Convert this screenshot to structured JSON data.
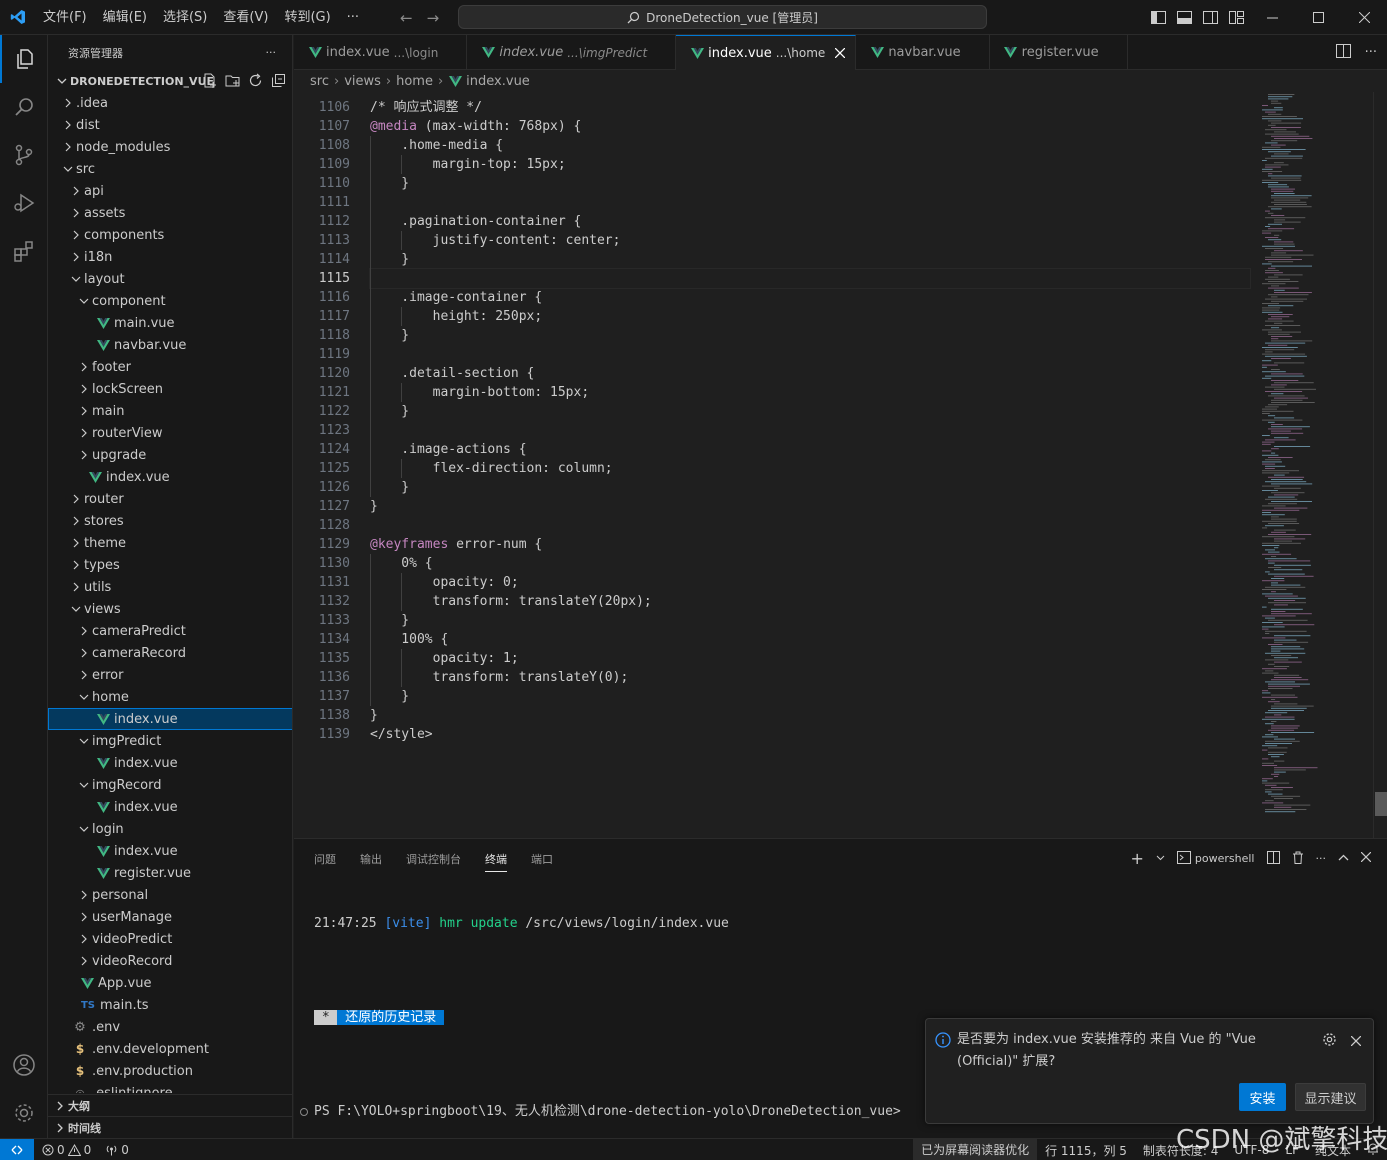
{
  "titlebar": {
    "menu": [
      "文件(F)",
      "编辑(E)",
      "选择(S)",
      "查看(V)",
      "转到(G)",
      "···"
    ],
    "command_center": "DroneDetection_vue [管理员]"
  },
  "sidebar": {
    "title": "资源管理器",
    "more": "···",
    "project": "DRONEDETECTION_VUE",
    "tree": [
      {
        "label": ".idea",
        "depth": 0,
        "type": "folder",
        "open": false
      },
      {
        "label": "dist",
        "depth": 0,
        "type": "folder",
        "open": false
      },
      {
        "label": "node_modules",
        "depth": 0,
        "type": "folder",
        "open": false
      },
      {
        "label": "src",
        "depth": 0,
        "type": "folder",
        "open": true
      },
      {
        "label": "api",
        "depth": 1,
        "type": "folder",
        "open": false
      },
      {
        "label": "assets",
        "depth": 1,
        "type": "folder",
        "open": false
      },
      {
        "label": "components",
        "depth": 1,
        "type": "folder",
        "open": false
      },
      {
        "label": "i18n",
        "depth": 1,
        "type": "folder",
        "open": false
      },
      {
        "label": "layout",
        "depth": 1,
        "type": "folder",
        "open": true
      },
      {
        "label": "component",
        "depth": 2,
        "type": "folder",
        "open": true
      },
      {
        "label": "main.vue",
        "depth": 3,
        "type": "vue"
      },
      {
        "label": "navbar.vue",
        "depth": 3,
        "type": "vue"
      },
      {
        "label": "footer",
        "depth": 2,
        "type": "folder",
        "open": false
      },
      {
        "label": "lockScreen",
        "depth": 2,
        "type": "folder",
        "open": false
      },
      {
        "label": "main",
        "depth": 2,
        "type": "folder",
        "open": false
      },
      {
        "label": "routerView",
        "depth": 2,
        "type": "folder",
        "open": false
      },
      {
        "label": "upgrade",
        "depth": 2,
        "type": "folder",
        "open": false
      },
      {
        "label": "index.vue",
        "depth": 2,
        "type": "vue"
      },
      {
        "label": "router",
        "depth": 1,
        "type": "folder",
        "open": false
      },
      {
        "label": "stores",
        "depth": 1,
        "type": "folder",
        "open": false
      },
      {
        "label": "theme",
        "depth": 1,
        "type": "folder",
        "open": false
      },
      {
        "label": "types",
        "depth": 1,
        "type": "folder",
        "open": false
      },
      {
        "label": "utils",
        "depth": 1,
        "type": "folder",
        "open": false
      },
      {
        "label": "views",
        "depth": 1,
        "type": "folder",
        "open": true
      },
      {
        "label": "cameraPredict",
        "depth": 2,
        "type": "folder",
        "open": false
      },
      {
        "label": "cameraRecord",
        "depth": 2,
        "type": "folder",
        "open": false
      },
      {
        "label": "error",
        "depth": 2,
        "type": "folder",
        "open": false
      },
      {
        "label": "home",
        "depth": 2,
        "type": "folder",
        "open": true
      },
      {
        "label": "index.vue",
        "depth": 3,
        "type": "vue",
        "selected": true
      },
      {
        "label": "imgPredict",
        "depth": 2,
        "type": "folder",
        "open": true
      },
      {
        "label": "index.vue",
        "depth": 3,
        "type": "vue"
      },
      {
        "label": "imgRecord",
        "depth": 2,
        "type": "folder",
        "open": true
      },
      {
        "label": "index.vue",
        "depth": 3,
        "type": "vue"
      },
      {
        "label": "login",
        "depth": 2,
        "type": "folder",
        "open": true
      },
      {
        "label": "index.vue",
        "depth": 3,
        "type": "vue"
      },
      {
        "label": "register.vue",
        "depth": 3,
        "type": "vue"
      },
      {
        "label": "personal",
        "depth": 2,
        "type": "folder",
        "open": false
      },
      {
        "label": "userManage",
        "depth": 2,
        "type": "folder",
        "open": false
      },
      {
        "label": "videoPredict",
        "depth": 2,
        "type": "folder",
        "open": false
      },
      {
        "label": "videoRecord",
        "depth": 2,
        "type": "folder",
        "open": false
      },
      {
        "label": "App.vue",
        "depth": 1,
        "type": "vue"
      },
      {
        "label": "main.ts",
        "depth": 1,
        "type": "ts"
      },
      {
        "label": ".env",
        "depth": 0,
        "type": "gear"
      },
      {
        "label": ".env.development",
        "depth": 0,
        "type": "dollar"
      },
      {
        "label": ".env.production",
        "depth": 0,
        "type": "dollar"
      },
      {
        "label": ".eslintignore",
        "depth": 0,
        "type": "circle"
      }
    ],
    "outline": "大纲",
    "timeline": "时间线"
  },
  "tabs": [
    {
      "name": "index.vue",
      "desc": "...\\login",
      "italic": false,
      "active": false
    },
    {
      "name": "index.vue",
      "desc": "...\\imgPredict",
      "italic": true,
      "active": false
    },
    {
      "name": "index.vue",
      "desc": "...\\home",
      "italic": false,
      "active": true
    },
    {
      "name": "navbar.vue",
      "desc": "",
      "italic": false,
      "active": false
    },
    {
      "name": "register.vue",
      "desc": "",
      "italic": false,
      "active": false
    }
  ],
  "breadcrumb": [
    "src",
    "views",
    "home",
    "index.vue"
  ],
  "editor": {
    "current_line": 1115,
    "lines": [
      {
        "n": 1106,
        "tokens": [
          [
            "/* 响应式调整 */",
            "comment"
          ]
        ]
      },
      {
        "n": 1107,
        "tokens": [
          [
            "@media",
            "at"
          ],
          [
            " (max-width: 768px) {",
            "plain"
          ]
        ]
      },
      {
        "n": 1108,
        "tokens": [
          [
            "    .home-media {",
            "plain"
          ]
        ]
      },
      {
        "n": 1109,
        "tokens": [
          [
            "        margin-top: 15px;",
            "plain"
          ]
        ]
      },
      {
        "n": 1110,
        "tokens": [
          [
            "    }",
            "plain"
          ]
        ]
      },
      {
        "n": 1111,
        "tokens": []
      },
      {
        "n": 1112,
        "tokens": [
          [
            "    .pagination-container {",
            "plain"
          ]
        ]
      },
      {
        "n": 1113,
        "tokens": [
          [
            "        justify-content: center;",
            "plain"
          ]
        ]
      },
      {
        "n": 1114,
        "tokens": [
          [
            "    }",
            "plain"
          ]
        ]
      },
      {
        "n": 1115,
        "tokens": []
      },
      {
        "n": 1116,
        "tokens": [
          [
            "    .image-container {",
            "plain"
          ]
        ]
      },
      {
        "n": 1117,
        "tokens": [
          [
            "        height: 250px;",
            "plain"
          ]
        ]
      },
      {
        "n": 1118,
        "tokens": [
          [
            "    }",
            "plain"
          ]
        ]
      },
      {
        "n": 1119,
        "tokens": []
      },
      {
        "n": 1120,
        "tokens": [
          [
            "    .detail-section {",
            "plain"
          ]
        ]
      },
      {
        "n": 1121,
        "tokens": [
          [
            "        margin-bottom: 15px;",
            "plain"
          ]
        ]
      },
      {
        "n": 1122,
        "tokens": [
          [
            "    }",
            "plain"
          ]
        ]
      },
      {
        "n": 1123,
        "tokens": []
      },
      {
        "n": 1124,
        "tokens": [
          [
            "    .image-actions {",
            "plain"
          ]
        ]
      },
      {
        "n": 1125,
        "tokens": [
          [
            "        flex-direction: column;",
            "plain"
          ]
        ]
      },
      {
        "n": 1126,
        "tokens": [
          [
            "    }",
            "plain"
          ]
        ]
      },
      {
        "n": 1127,
        "tokens": [
          [
            "}",
            "plain"
          ]
        ]
      },
      {
        "n": 1128,
        "tokens": []
      },
      {
        "n": 1129,
        "tokens": [
          [
            "@keyframes",
            "at"
          ],
          [
            " error-num {",
            "plain"
          ]
        ]
      },
      {
        "n": 1130,
        "tokens": [
          [
            "    0% {",
            "plain"
          ]
        ]
      },
      {
        "n": 1131,
        "tokens": [
          [
            "        opacity: 0;",
            "plain"
          ]
        ]
      },
      {
        "n": 1132,
        "tokens": [
          [
            "        transform: translateY(20px);",
            "plain"
          ]
        ]
      },
      {
        "n": 1133,
        "tokens": [
          [
            "    }",
            "plain"
          ]
        ]
      },
      {
        "n": 1134,
        "tokens": [
          [
            "    100% {",
            "plain"
          ]
        ]
      },
      {
        "n": 1135,
        "tokens": [
          [
            "        opacity: 1;",
            "plain"
          ]
        ]
      },
      {
        "n": 1136,
        "tokens": [
          [
            "        transform: translateY(0);",
            "plain"
          ]
        ]
      },
      {
        "n": 1137,
        "tokens": [
          [
            "    }",
            "plain"
          ]
        ]
      },
      {
        "n": 1138,
        "tokens": [
          [
            "}",
            "plain"
          ]
        ]
      },
      {
        "n": 1139,
        "tokens": [
          [
            "</style>",
            "plain"
          ]
        ]
      }
    ]
  },
  "panel": {
    "tabs": [
      "问题",
      "输出",
      "调试控制台",
      "终端",
      "端口"
    ],
    "active_tab": "终端",
    "shell": "powershell",
    "terminal": {
      "time": "21:47:25",
      "vite": "[vite]",
      "hmr": "hmr",
      "update": "update",
      "path": "/src/views/login/index.vue",
      "restore_star": " * ",
      "restore": " 还原的历史记录 ",
      "prompt": "PS F:\\YOLO+springboot\\19、无人机检测\\drone-detection-yolo\\DroneDetection_vue>"
    }
  },
  "notification": {
    "message": "是否要为 index.vue 安装推荐的 来自 Vue 的 \"Vue (Official)\" 扩展?",
    "install": "安装",
    "show": "显示建议"
  },
  "statusbar": {
    "errors": "0",
    "warnings": "0",
    "ports": "0",
    "screenreader": "已为屏幕阅读器优化",
    "position": "行 1115，列 5",
    "tabsize": "制表符长度: 4",
    "encoding": "UTF-8",
    "eol": "LF",
    "lang": "纯文本"
  },
  "watermark": "CSDN @斌擎科技",
  "colors": {
    "accent": "#0078d4",
    "vue": "#41b883",
    "ts": "#3178c6",
    "env": "#e5c07b",
    "at": "#c586c0",
    "comment": "#6a9955"
  }
}
